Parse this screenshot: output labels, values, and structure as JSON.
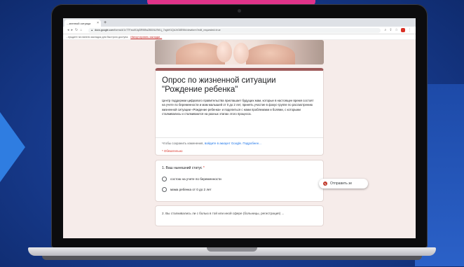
{
  "browser": {
    "tab_title": "...зненной ситуаци",
    "tab_close": "×",
    "new_tab": "+",
    "url_host": "docs.google.com",
    "url_rest": "/forms/d/1vT7Fzsd9Jqi3R9lBw2B8XkJ9W-j_7xgbH1QdJrG8E9Ib/viewform?edit_requested=true",
    "bookmarks_text": "...ерьдите на панели закладок для быстрого доступа.",
    "bookmarks_link": "Импортировать закладки..."
  },
  "form": {
    "title_line1": "Опрос по жизненной ситуации",
    "title_line2": "\"Рождение ребенка\"",
    "description": "Центр поддержки цифрового правительства приглашает будущих мам, которые в настоящее время состоят на учете по беременности и мам малышей от 0 до 2 лет, принять участие в фокус-группе по рассмотрению жизненной ситуации «Рождение ребенка» и поделиться с нами проблемами и болями, с которыми сталкивались и сталкиваются на разных этапах этого процесса.",
    "signin_text": "Чтобы сохранить изменения, ",
    "signin_link": "войдите в аккаунт Google. Подробнее...",
    "required_note": "* Обязательно"
  },
  "question1": {
    "title": "1. Ваш нынешний статус",
    "star": "*",
    "options": [
      "состою на учете по беременности",
      "мама ребенка от 0 до 2 лет"
    ]
  },
  "question2": {
    "title_partial": "2. Вы сталкивались ли с болью в той или иной сфере (больницы, регистрация) ..."
  },
  "send_button": {
    "label": "Отправить зе"
  },
  "colors": {
    "accent": "#9e5a5a",
    "page_bg": "#f6ecea",
    "link": "#1a73e8",
    "required": "#d93025",
    "background": "#173a8c"
  }
}
